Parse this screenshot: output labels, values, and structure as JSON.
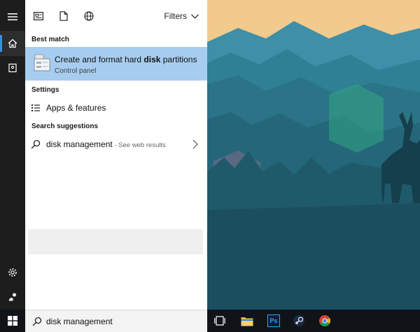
{
  "topbar": {
    "filters_label": "Filters",
    "icons": [
      "apps-icon",
      "documents-icon",
      "web-icon",
      "chevron-down-icon"
    ]
  },
  "sections": {
    "best_match": "Best match",
    "settings": "Settings",
    "search_suggestions": "Search suggestions"
  },
  "best_match": {
    "title_prefix": "Create and format hard ",
    "title_bold": "disk",
    "title_suffix": " partitions",
    "subtitle": "Control panel",
    "icon": "disk-management-icon"
  },
  "settings_items": [
    {
      "label": "Apps & features",
      "icon": "list-icon"
    }
  ],
  "suggestions": [
    {
      "query": "disk management",
      "hint": " - See web results",
      "icon": "search-icon"
    }
  ],
  "search": {
    "value": "disk management"
  },
  "rail": {
    "items": [
      "hamburger-menu-icon",
      "home-icon",
      "notebook-icon",
      "settings-gear-icon",
      "feedback-icon"
    ]
  },
  "taskbar": {
    "icons": [
      "task-view-icon",
      "file-explorer-icon",
      "photoshop-icon",
      "steam-icon",
      "chrome-icon"
    ],
    "photoshop_text": "Ps"
  },
  "colors": {
    "selection": "#a6cdef",
    "rail_bg": "#1d1d1d",
    "taskbar_bg": "#101418",
    "accent": "#3a8ee6"
  }
}
